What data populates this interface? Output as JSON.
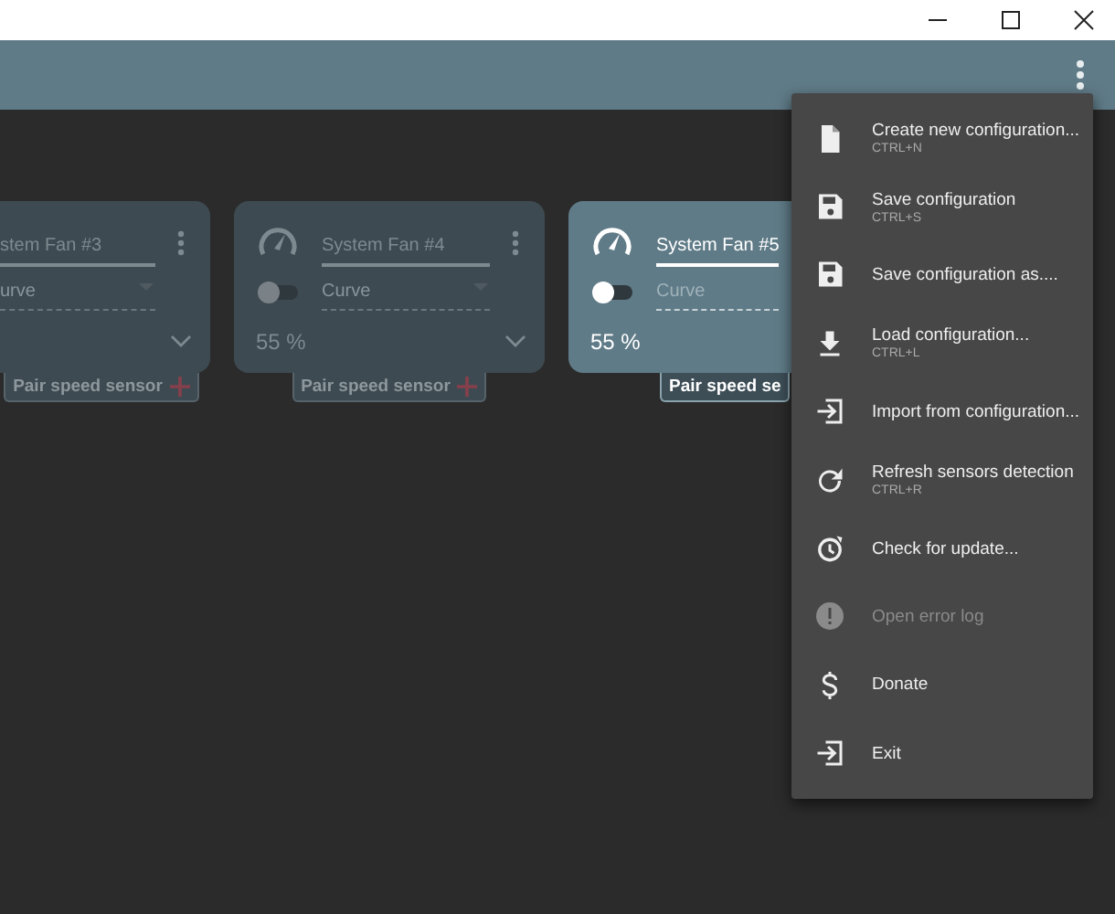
{
  "fans": [
    {
      "kind": "cut-left",
      "name": "stem Fan #3",
      "mode": "urve",
      "selected": false,
      "badge": "Pair speed sensor"
    },
    {
      "kind": "full",
      "name": "System Fan #4",
      "mode": "Curve",
      "selected": false,
      "percent": "55 %",
      "badge": "Pair speed sensor"
    },
    {
      "kind": "cut-right",
      "name": "System Fan #5",
      "mode": "Curve",
      "selected": true,
      "percent": "55 %",
      "badge": "Pair speed se"
    }
  ],
  "menu": [
    {
      "label": "Create new configuration...",
      "shortcut": "CTRL+N",
      "disabled": false
    },
    {
      "label": "Save configuration",
      "shortcut": "CTRL+S",
      "disabled": false
    },
    {
      "label": "Save configuration as....",
      "disabled": false
    },
    {
      "label": "Load configuration...",
      "shortcut": "CTRL+L",
      "disabled": false
    },
    {
      "label": "Import from configuration...",
      "disabled": false
    },
    {
      "label": "Refresh sensors detection",
      "shortcut": "CTRL+R",
      "disabled": false
    },
    {
      "label": "Check for update...",
      "disabled": false
    },
    {
      "label": "Open error log",
      "disabled": true
    },
    {
      "label": "Donate",
      "disabled": false
    },
    {
      "label": "Exit",
      "disabled": false
    }
  ]
}
